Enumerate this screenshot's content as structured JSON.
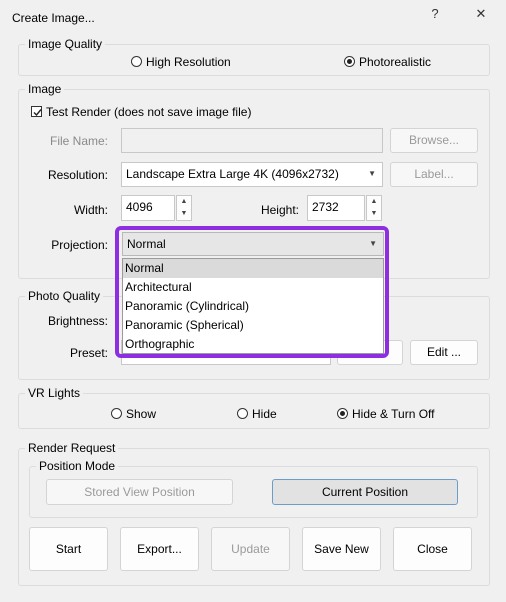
{
  "window": {
    "title": "Create Image...",
    "help": "?",
    "close": "✕"
  },
  "image_quality": {
    "legend": "Image Quality",
    "options": [
      "High Resolution",
      "Photorealistic"
    ],
    "selected": "Photorealistic"
  },
  "image": {
    "legend": "Image",
    "test_render_label": "Test Render (does not save image file)",
    "test_render_checked": true,
    "file_name_label": "File Name:",
    "file_name_value": "",
    "browse_label": "Browse...",
    "resolution_label": "Resolution:",
    "resolution_value": "Landscape Extra Large 4K (4096x2732)",
    "label_button": "Label...",
    "width_label": "Width:",
    "width_value": "4096",
    "height_label": "Height:",
    "height_value": "2732",
    "projection_label": "Projection:",
    "projection_value": "Normal",
    "projection_options": [
      "Normal",
      "Architectural",
      "Panoramic (Cylindrical)",
      "Panoramic (Spherical)",
      "Orthographic"
    ]
  },
  "photo_quality": {
    "legend": "Photo Quality",
    "brightness_label": "Brightness:",
    "preset_label": "Preset:",
    "edit_label": "Edit ..."
  },
  "vr_lights": {
    "legend": "VR Lights",
    "options": [
      "Show",
      "Hide",
      "Hide & Turn Off"
    ],
    "selected": "Hide & Turn Off"
  },
  "render_request": {
    "legend": "Render Request",
    "position_mode_legend": "Position Mode",
    "stored_view_label": "Stored View Position",
    "current_position_label": "Current Position",
    "actions": [
      "Start",
      "Export...",
      "Update",
      "Save New",
      "Close"
    ]
  },
  "colors": {
    "highlight": "#8d2fe0",
    "selection_border": "#6c9cc9"
  }
}
